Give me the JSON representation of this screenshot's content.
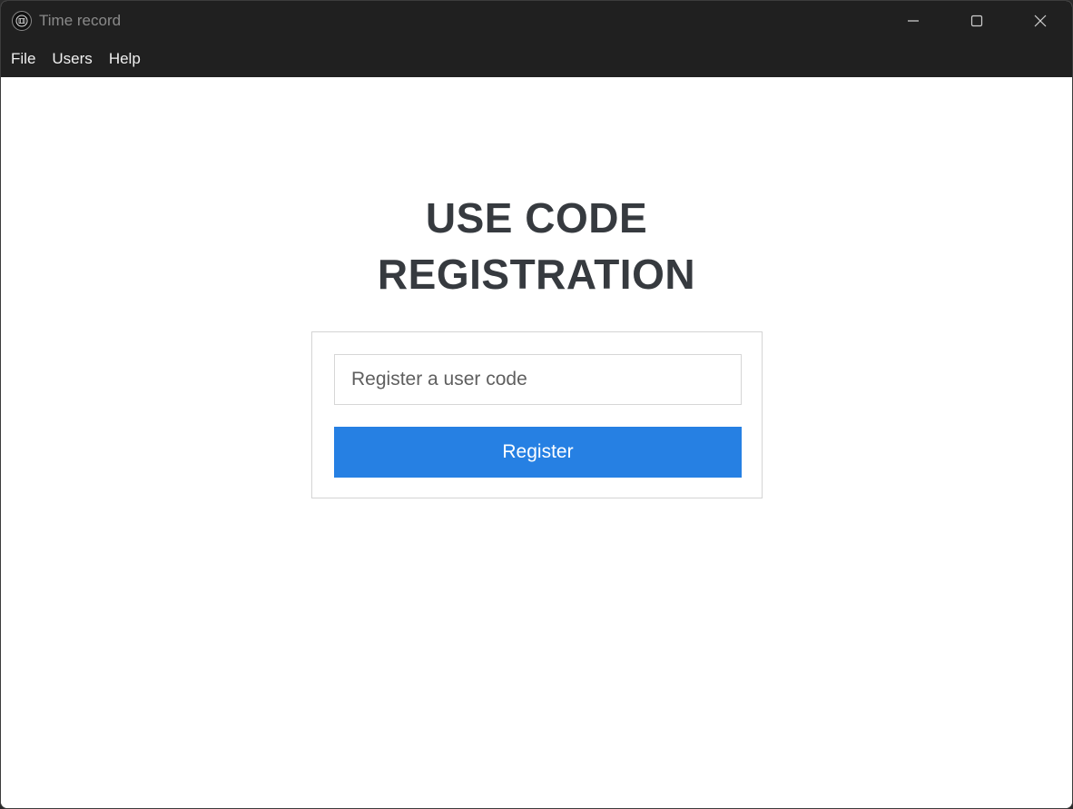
{
  "window": {
    "title": "Time record",
    "icon": "app-logo-icon",
    "controls": [
      "minimize-icon",
      "maximize-icon",
      "close-icon"
    ]
  },
  "menu": {
    "items": [
      {
        "label": "File"
      },
      {
        "label": "Users"
      },
      {
        "label": "Help"
      }
    ]
  },
  "main": {
    "heading_line1": "USE CODE",
    "heading_line2": "REGISTRATION",
    "input": {
      "value": "",
      "placeholder": "Register a user code"
    },
    "register_label": "Register"
  },
  "colors": {
    "titlebar_bg": "#202020",
    "accent": "#2680e3",
    "heading": "#363a3f"
  }
}
